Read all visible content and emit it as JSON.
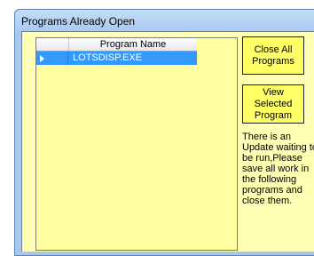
{
  "window": {
    "title": "Programs Already Open"
  },
  "grid": {
    "columns": [
      "Program Name"
    ],
    "rows": [
      {
        "program_name": "LOTSDISP.EXE",
        "selected": true
      }
    ]
  },
  "buttons": {
    "close_all": "Close All Programs",
    "view_selected": "View Selected Program"
  },
  "notice_text": "There is an Update waiting to be run,Please save all work in the following programs and close them.",
  "colors": {
    "background": "#ffffb4",
    "button": "#ffff66",
    "selection": "#3399ff",
    "titlebar": "#a6c8ef"
  },
  "icons": [
    "row-pointer-icon"
  ]
}
